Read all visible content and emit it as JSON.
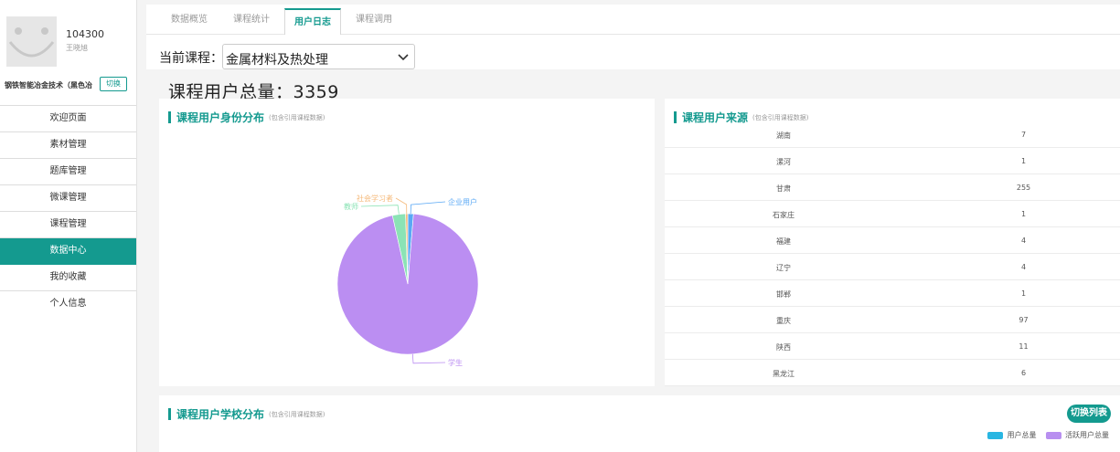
{
  "user": {
    "id": "104300",
    "name": "王晓旭"
  },
  "course_banner": {
    "name": "钢铁智能冶金技术（黑色冶",
    "switch_label": "切换"
  },
  "menu": [
    {
      "label": "欢迎页面",
      "active": false
    },
    {
      "label": "素材管理",
      "active": false
    },
    {
      "label": "题库管理",
      "active": false
    },
    {
      "label": "微课管理",
      "active": false
    },
    {
      "label": "课程管理",
      "active": false
    },
    {
      "label": "数据中心",
      "active": true
    },
    {
      "label": "我的收藏",
      "active": false
    },
    {
      "label": "个人信息",
      "active": false
    }
  ],
  "tabs": [
    {
      "label": "数据概览",
      "active": false
    },
    {
      "label": "课程统计",
      "active": false
    },
    {
      "label": "用户日志",
      "active": true
    },
    {
      "label": "课程调用",
      "active": false
    }
  ],
  "selector": {
    "label": "当前课程：",
    "value": "金属材料及热处理"
  },
  "total": {
    "text": "课程用户总量：3359"
  },
  "identity_panel": {
    "title": "课程用户身份分布",
    "subtitle": "(包含引用课程数据)"
  },
  "source_panel": {
    "title": "课程用户来源",
    "subtitle": "(包含引用课程数据)",
    "rows": [
      {
        "name": "湖南",
        "count": "7"
      },
      {
        "name": "漯河",
        "count": "1"
      },
      {
        "name": "甘肃",
        "count": "255"
      },
      {
        "name": "石家庄",
        "count": "1"
      },
      {
        "name": "福建",
        "count": "4"
      },
      {
        "name": "辽宁",
        "count": "4"
      },
      {
        "name": "邯郸",
        "count": "1"
      },
      {
        "name": "重庆",
        "count": "97"
      },
      {
        "name": "陕西",
        "count": "11"
      },
      {
        "name": "黑龙江",
        "count": "6"
      }
    ]
  },
  "school_panel": {
    "title": "课程用户学校分布",
    "subtitle": "(包含引用课程数据)",
    "toggle_label": "切换列表",
    "legend": [
      {
        "label": "用户总量",
        "color": "#29b6e2"
      },
      {
        "label": "活跃用户总量",
        "color": "#b88ff0"
      }
    ]
  },
  "chart_data": {
    "type": "pie",
    "slices": [
      {
        "label": "企业用户",
        "value": 1.3,
        "color": "#5aa8f5"
      },
      {
        "label": "学生",
        "value": 95.2,
        "color": "#bb8ef2"
      },
      {
        "label": "教师",
        "value": 3.0,
        "color": "#8be3b5"
      },
      {
        "label": "社会学习者",
        "value": 0.5,
        "color": "#f5b97a"
      }
    ]
  },
  "colors": {
    "accent": "#149a8f"
  }
}
